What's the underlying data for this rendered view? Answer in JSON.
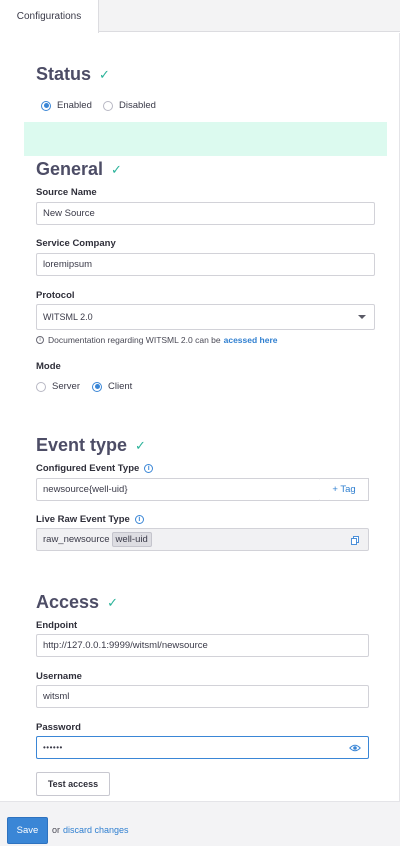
{
  "tabs": [
    {
      "label": "Configurations"
    }
  ],
  "status": {
    "title": "Status",
    "options": [
      {
        "label": "Enabled",
        "selected": true
      },
      {
        "label": "Disabled",
        "selected": false
      }
    ]
  },
  "general": {
    "title": "General",
    "source_name_label": "Source Name",
    "source_name_value": "New Source",
    "service_company_label": "Service Company",
    "service_company_value": "loremipsum",
    "protocol_label": "Protocol",
    "protocol_value": "WITSML 2.0",
    "protocol_help": "Documentation regarding WITSML 2.0 can be",
    "protocol_help_link": "acessed here",
    "mode_label": "Mode",
    "mode_options": [
      {
        "label": "Server",
        "selected": false
      },
      {
        "label": "Client",
        "selected": true
      }
    ]
  },
  "event_type": {
    "title": "Event type",
    "configured_label": "Configured Event Type",
    "configured_value": "newsource{well-uid}",
    "tag_button": "+ Tag",
    "live_raw_label": "Live Raw Event Type",
    "live_raw_prefix": "raw_newsource",
    "live_raw_chip": "well-uid"
  },
  "access": {
    "title": "Access",
    "endpoint_label": "Endpoint",
    "endpoint_value": "http://127.0.0.1:9999/witsml/newsource",
    "username_label": "Username",
    "username_value": "witsml",
    "password_label": "Password",
    "password_value": "••••••",
    "test_button": "Test access"
  },
  "footer": {
    "save_label": "Save",
    "or_text": "or",
    "discard_label": "discard changes"
  },
  "colors": {
    "accent": "#3a86d6",
    "success": "#2bb39a",
    "status_bg": "#dcfaef"
  }
}
